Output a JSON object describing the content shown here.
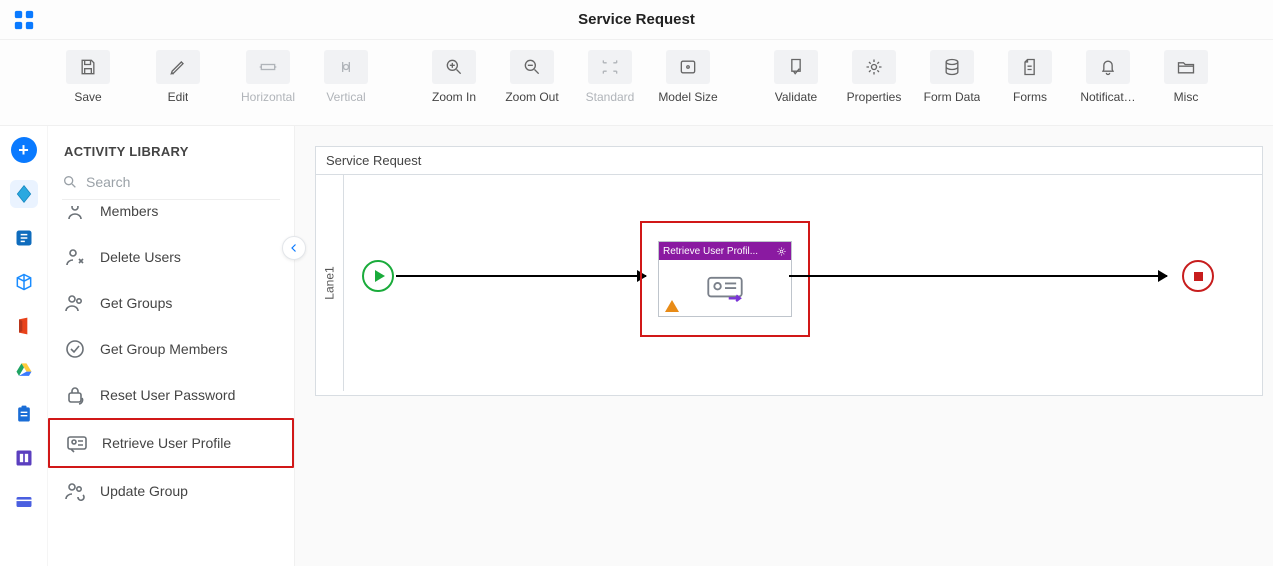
{
  "header": {
    "title": "Service Request"
  },
  "toolbar": [
    {
      "id": "save",
      "label": "Save",
      "disabled": false
    },
    {
      "id": "edit",
      "label": "Edit",
      "disabled": false
    },
    {
      "id": "horizontal",
      "label": "Horizontal",
      "disabled": true
    },
    {
      "id": "vertical",
      "label": "Vertical",
      "disabled": true
    },
    {
      "id": "zoom-in",
      "label": "Zoom In",
      "disabled": false
    },
    {
      "id": "zoom-out",
      "label": "Zoom Out",
      "disabled": false
    },
    {
      "id": "standard",
      "label": "Standard",
      "disabled": true
    },
    {
      "id": "model-size",
      "label": "Model Size",
      "disabled": false
    },
    {
      "id": "validate",
      "label": "Validate",
      "disabled": false
    },
    {
      "id": "properties",
      "label": "Properties",
      "disabled": false
    },
    {
      "id": "form-data",
      "label": "Form Data",
      "disabled": false
    },
    {
      "id": "forms",
      "label": "Forms",
      "disabled": false
    },
    {
      "id": "notifications",
      "label": "Notificat…",
      "disabled": false
    },
    {
      "id": "misc",
      "label": "Misc",
      "disabled": false
    }
  ],
  "panel": {
    "title": "ACTIVITY LIBRARY",
    "search_placeholder": "Search",
    "items": [
      {
        "id": "members",
        "label": "Members"
      },
      {
        "id": "delete-users",
        "label": "Delete Users"
      },
      {
        "id": "get-groups",
        "label": "Get Groups"
      },
      {
        "id": "get-group-members",
        "label": "Get Group Members"
      },
      {
        "id": "reset-user-password",
        "label": "Reset User Password"
      },
      {
        "id": "retrieve-user-profile",
        "label": "Retrieve User Profile",
        "highlight": true
      },
      {
        "id": "update-group",
        "label": "Update Group"
      }
    ]
  },
  "diagram": {
    "title": "Service Request",
    "lane": "Lane1",
    "activity_node": {
      "title": "Retrieve User Profil..."
    }
  }
}
